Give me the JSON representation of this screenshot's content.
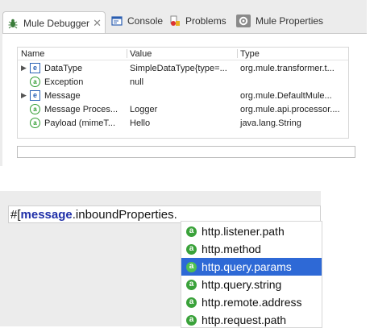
{
  "tabs": [
    {
      "label": "Mule Debugger",
      "icon": "bug-icon",
      "close": "✕"
    },
    {
      "label": "Console",
      "icon": "console-icon"
    },
    {
      "label": "Problems",
      "icon": "problems-icon"
    },
    {
      "label": "Mule Properties",
      "icon": "gear-icon"
    }
  ],
  "table": {
    "headers": {
      "name": "Name",
      "value": "Value",
      "type": "Type"
    },
    "rows": [
      {
        "expandable": true,
        "icon": "e",
        "name": "DataType",
        "value": "SimpleDataType{type=...",
        "type": "org.mule.transformer.t..."
      },
      {
        "expandable": false,
        "icon": "a",
        "name": "Exception",
        "value": "null",
        "type": ""
      },
      {
        "expandable": true,
        "icon": "e",
        "name": "Message",
        "value": "",
        "type": "org.mule.DefaultMule..."
      },
      {
        "expandable": false,
        "icon": "a",
        "name": "Message Proces...",
        "value": "Logger",
        "type": "org.mule.api.processor...."
      },
      {
        "expandable": false,
        "icon": "a",
        "name": "Payload (mimeT...",
        "value": "Hello",
        "type": "java.lang.String"
      }
    ]
  },
  "editor": {
    "prefix": "#[",
    "keyword": "message",
    "rest": ".inboundProperties."
  },
  "suggestions": [
    {
      "label": "http.listener.path",
      "selected": false
    },
    {
      "label": "http.method",
      "selected": false
    },
    {
      "label": "http.query.params",
      "selected": true
    },
    {
      "label": "http.query.string",
      "selected": false
    },
    {
      "label": "http.remote.address",
      "selected": false
    },
    {
      "label": "http.request.path",
      "selected": false
    }
  ],
  "colors": {
    "selection": "#2e69d6",
    "attribute_icon": "#3aa23a",
    "expandable_icon": "#2a63b6"
  }
}
